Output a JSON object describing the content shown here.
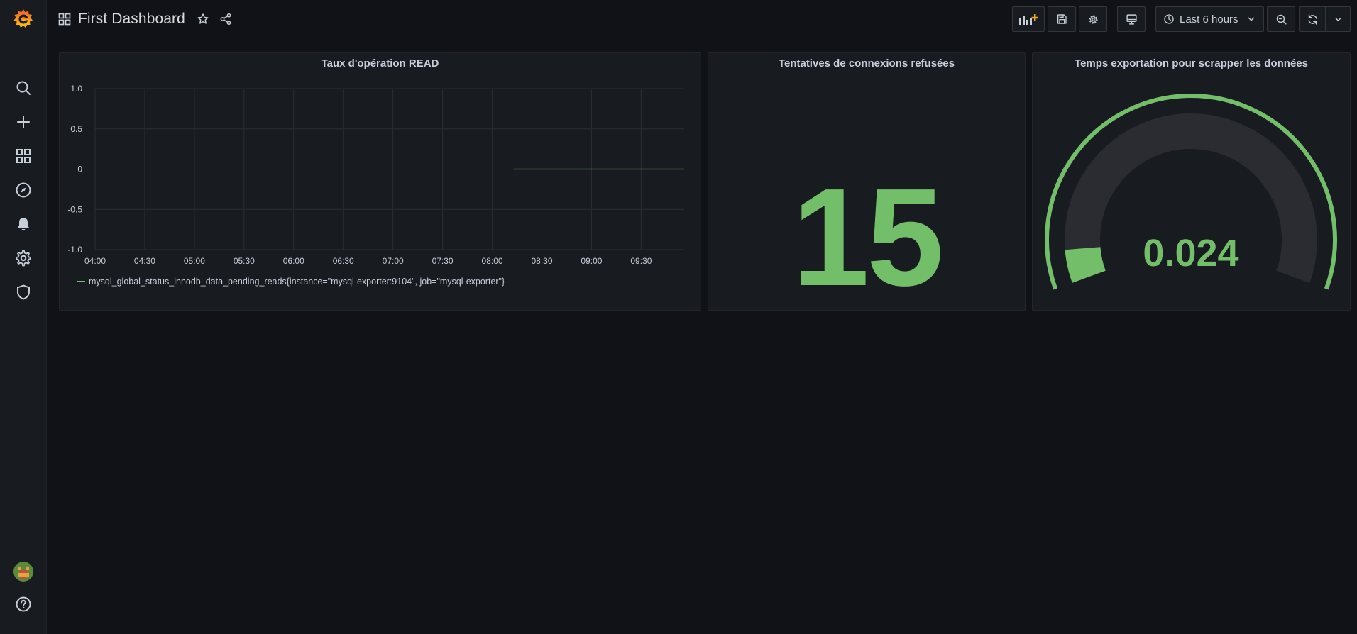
{
  "header": {
    "title": "First Dashboard",
    "time_range": "Last 6 hours"
  },
  "sidebar": {
    "items": [
      "search-icon",
      "plus-icon",
      "dashboards-icon",
      "explore-icon",
      "alerting-icon",
      "configuration-icon",
      "shield-icon"
    ],
    "bottom": [
      "avatar",
      "help-icon"
    ]
  },
  "panels": {
    "read_ops": {
      "title": "Taux d'opération READ",
      "legend": "mysql_global_status_innodb_data_pending_reads{instance=\"mysql-exporter:9104\", job=\"mysql-exporter\"}"
    },
    "refused": {
      "title": "Tentatives de connexions refusées",
      "value": "15"
    },
    "export_time": {
      "title": "Temps exportation pour scrapper les données",
      "value": "0.024"
    }
  },
  "colors": {
    "accent_green": "#73bf69",
    "brand_orange": "#f05a28",
    "background": "#111217",
    "panel": "#181b1f"
  },
  "chart_data": [
    {
      "type": "line",
      "title": "Taux d'opération READ",
      "xlabel": "",
      "ylabel": "",
      "x_ticks": [
        "04:00",
        "04:30",
        "05:00",
        "05:30",
        "06:00",
        "06:30",
        "07:00",
        "07:30",
        "08:00",
        "08:30",
        "09:00",
        "09:30"
      ],
      "y_ticks": [
        "1.0",
        "0.5",
        "0",
        "-0.5",
        "-1.0"
      ],
      "ylim": [
        -1.0,
        1.0
      ],
      "xlim": [
        "04:00",
        "09:56"
      ],
      "grid": true,
      "legend_position": "bottom-left",
      "series": [
        {
          "name": "mysql_global_status_innodb_data_pending_reads{instance=\"mysql-exporter:9104\", job=\"mysql-exporter\"}",
          "color": "#73bf69",
          "x": [
            "08:13",
            "09:56"
          ],
          "y": [
            0,
            0
          ]
        }
      ]
    },
    {
      "type": "gauge",
      "title": "Temps exportation pour scrapper les données",
      "value": 0.024,
      "fill_fraction": 0.07,
      "color": "#73bf69"
    }
  ]
}
